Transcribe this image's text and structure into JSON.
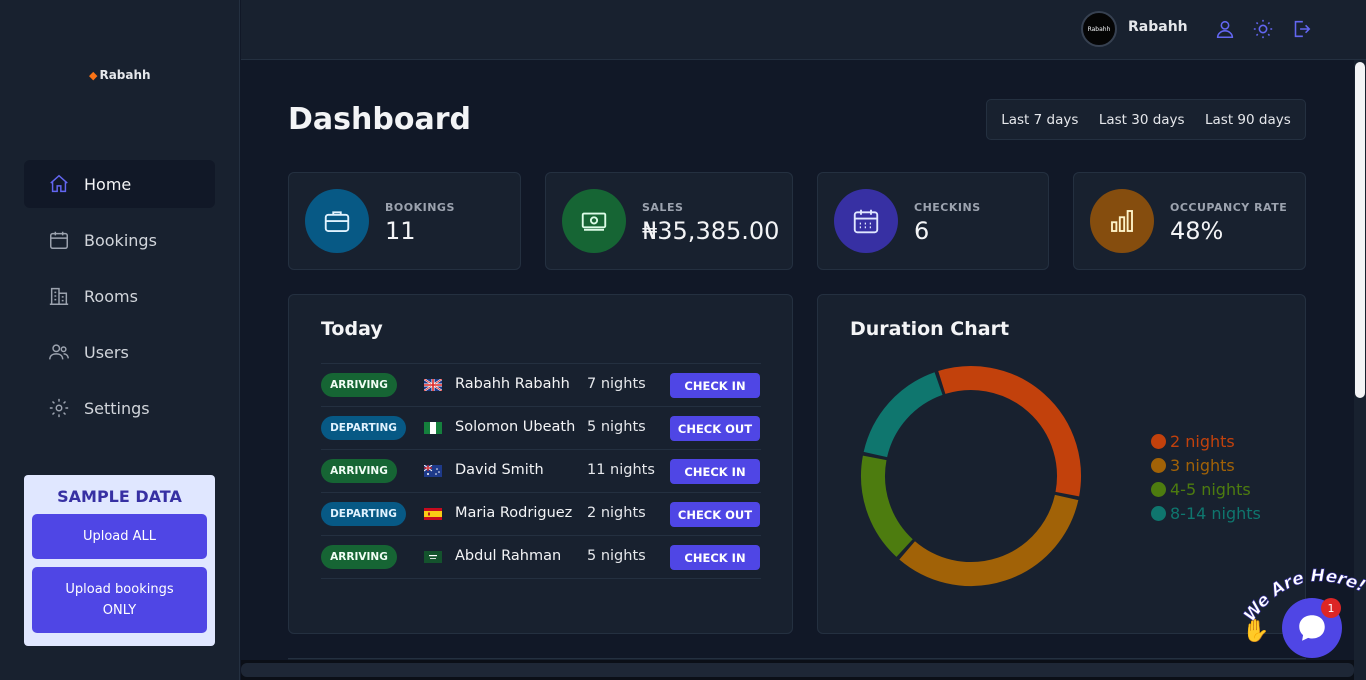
{
  "brand": {
    "name": "Rabahh"
  },
  "sidebar": {
    "items": [
      {
        "label": "Home",
        "icon": "home-icon",
        "active": true
      },
      {
        "label": "Bookings",
        "icon": "calendar-icon"
      },
      {
        "label": "Rooms",
        "icon": "building-icon"
      },
      {
        "label": "Users",
        "icon": "users-icon"
      },
      {
        "label": "Settings",
        "icon": "gear-icon"
      }
    ],
    "sample": {
      "title": "SAMPLE DATA",
      "upload_all": "Upload ALL",
      "upload_bookings": "Upload bookings ONLY"
    }
  },
  "header": {
    "user_name": "Rabahh",
    "avatar_text": "Rabahh"
  },
  "page": {
    "title": "Dashboard"
  },
  "filters": [
    "Last 7 days",
    "Last 30 days",
    "Last 90 days"
  ],
  "stats": [
    {
      "label": "BOOKINGS",
      "value": "11",
      "color": "#075985",
      "icon": "briefcase-icon"
    },
    {
      "label": "SALES",
      "value": "₦35,385.00",
      "color": "#166534",
      "icon": "banknotes-icon"
    },
    {
      "label": "CHECKINS",
      "value": "6",
      "color": "#3730a3",
      "icon": "calendar-days-icon"
    },
    {
      "label": "OCCUPANCY RATE",
      "value": "48%",
      "color": "#854d0e",
      "icon": "chart-bar-icon"
    }
  ],
  "today": {
    "title": "Today",
    "rows": [
      {
        "status": "ARRIVING",
        "flag": "gb",
        "name": "Rabahh Rabahh",
        "nights": "7 nights",
        "action": "CHECK IN"
      },
      {
        "status": "DEPARTING",
        "flag": "ng",
        "name": "Solomon Ubeath",
        "nights": "5 nights",
        "action": "CHECK OUT"
      },
      {
        "status": "ARRIVING",
        "flag": "au",
        "name": "David Smith",
        "nights": "11 nights",
        "action": "CHECK IN"
      },
      {
        "status": "DEPARTING",
        "flag": "es",
        "name": "Maria Rodriguez",
        "nights": "2 nights",
        "action": "CHECK OUT"
      },
      {
        "status": "ARRIVING",
        "flag": "sa",
        "name": "Abdul Rahman",
        "nights": "5 nights",
        "action": "CHECK IN"
      }
    ]
  },
  "duration": {
    "title": "Duration Chart"
  },
  "chart_data": {
    "type": "pie",
    "title": "Duration Chart",
    "categories": [
      "2 nights",
      "3 nights",
      "4-5 nights",
      "8-14 nights"
    ],
    "values": [
      2,
      2,
      1,
      1
    ],
    "colors": [
      "#c2410c",
      "#a16207",
      "#4d7c0f",
      "#0f766e"
    ]
  },
  "chat": {
    "tagline": "We Are Here!",
    "badge": "1"
  }
}
